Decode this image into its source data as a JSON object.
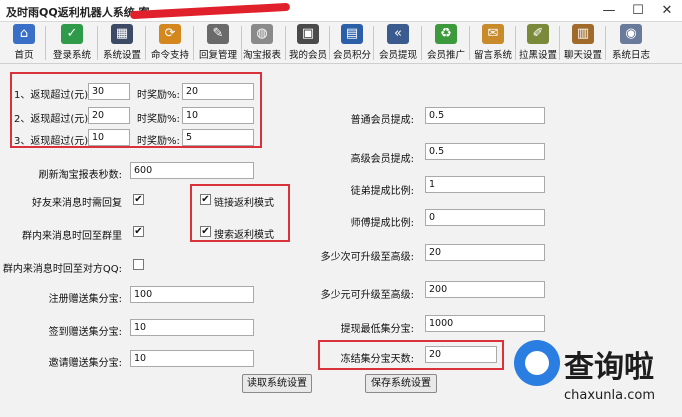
{
  "window": {
    "title": "及时雨QQ返利机器人系统 客",
    "controls": [
      "—",
      "☐",
      "✕"
    ]
  },
  "toolbar": [
    {
      "label": "首页",
      "icon": "home-icon",
      "color": "#3a6fc7",
      "glyph": "⌂"
    },
    {
      "label": "登录系统",
      "icon": "login-icon",
      "color": "#2e9a4a",
      "glyph": "✓"
    },
    {
      "label": "系统设置",
      "icon": "settings-icon",
      "color": "#3c4a66",
      "glyph": "▦"
    },
    {
      "label": "命令支持",
      "icon": "command-icon",
      "color": "#d4871c",
      "glyph": "⟳"
    },
    {
      "label": "回复管理",
      "icon": "reply-icon",
      "color": "#6a6a6a",
      "glyph": "✎"
    },
    {
      "label": "淘宝报表",
      "icon": "report-icon",
      "color": "#8a8a8a",
      "glyph": "◍"
    },
    {
      "label": "我的会员",
      "icon": "members-icon",
      "color": "#4a4a4a",
      "glyph": "▣"
    },
    {
      "label": "会员积分",
      "icon": "points-icon",
      "color": "#2b5fa8",
      "glyph": "▤"
    },
    {
      "label": "会员提现",
      "icon": "withdraw-icon",
      "color": "#3b5b8e",
      "glyph": "«"
    },
    {
      "label": "会员推广",
      "icon": "promote-icon",
      "color": "#3c9a3c",
      "glyph": "♻"
    },
    {
      "label": "留言系统",
      "icon": "message-icon",
      "color": "#c88a2a",
      "glyph": "✉"
    },
    {
      "label": "拉黑设置",
      "icon": "blacklist-icon",
      "color": "#7a8a3a",
      "glyph": "✐"
    },
    {
      "label": "聊天设置",
      "icon": "chat-icon",
      "color": "#a06a2a",
      "glyph": "▥"
    },
    {
      "label": "系统日志",
      "icon": "log-icon",
      "color": "#6a7a9a",
      "glyph": "◉"
    }
  ],
  "rebate_tiers": [
    {
      "label": "1、返现超过(元):",
      "amount": "30",
      "reward_label": "时奖励%:",
      "reward": "20"
    },
    {
      "label": "2、返现超过(元):",
      "amount": "20",
      "reward_label": "时奖励%:",
      "reward": "10"
    },
    {
      "label": "3、返现超过(元):",
      "amount": "10",
      "reward_label": "时奖励%:",
      "reward": "5"
    }
  ],
  "left": {
    "refresh_label": "刷新淘宝报表秒数:",
    "refresh_value": "600",
    "friend_reply_label": "好友来消息时需回复",
    "friend_reply_checked": "✔",
    "group_reply_label": "群内来消息时回至群里",
    "group_reply_checked": "✔",
    "group_private_label": "群内来消息时回至对方QQ:",
    "group_private_checked": "",
    "register_label": "注册赠送集分宝:",
    "register_value": "100",
    "signin_label": "签到赠送集分宝:",
    "signin_value": "10",
    "invite_label": "邀请赠送集分宝:",
    "invite_value": "10"
  },
  "modes": {
    "link_mode_label": "链接返利模式",
    "link_mode_checked": "✔",
    "search_mode_label": "搜索返利模式",
    "search_mode_checked": "✔"
  },
  "right": [
    {
      "label": "普通会员提成:",
      "value": "0.5"
    },
    {
      "label": "高级会员提成:",
      "value": "0.5"
    },
    {
      "label": "徒弟提成比例:",
      "value": "1"
    },
    {
      "label": "师傅提成比例:",
      "value": "0"
    },
    {
      "label": "多少次可升级至高级:",
      "value": "20"
    },
    {
      "label": "多少元可升级至高级:",
      "value": "200"
    },
    {
      "label": "提现最低集分宝:",
      "value": "1000"
    },
    {
      "label": "冻结集分宝天数:",
      "value": "20"
    }
  ],
  "buttons": {
    "read_settings": "读取系统设置",
    "save_settings": "保存系统设置"
  },
  "watermark": {
    "brand": "查询啦",
    "url": "chaxunla.com"
  }
}
